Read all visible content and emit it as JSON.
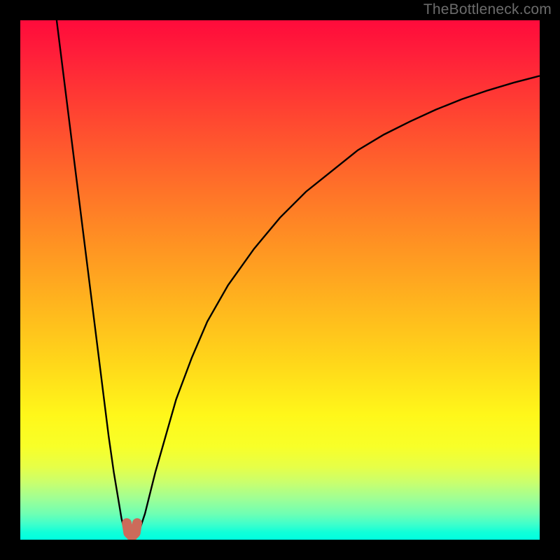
{
  "watermark": "TheBottleneck.com",
  "chart_data": {
    "type": "line",
    "title": "",
    "xlabel": "",
    "ylabel": "",
    "xlim": [
      0,
      100
    ],
    "ylim": [
      0,
      100
    ],
    "grid": false,
    "series": [
      {
        "name": "left-branch",
        "x": [
          7,
          8,
          9,
          10,
          11,
          12,
          13,
          14,
          15,
          16,
          17,
          18,
          19,
          19.5,
          20,
          20.5
        ],
        "values": [
          100,
          92,
          84,
          76,
          68,
          60,
          52,
          44,
          36,
          28,
          20,
          13,
          7,
          4,
          2,
          1
        ]
      },
      {
        "name": "right-branch",
        "x": [
          22.5,
          23,
          24,
          25,
          26,
          28,
          30,
          33,
          36,
          40,
          45,
          50,
          55,
          60,
          65,
          70,
          75,
          80,
          85,
          90,
          95,
          100
        ],
        "values": [
          1,
          2,
          5,
          9,
          13,
          20,
          27,
          35,
          42,
          49,
          56,
          62,
          67,
          71,
          75,
          78,
          80.5,
          82.8,
          84.8,
          86.5,
          88,
          89.3
        ]
      },
      {
        "name": "marker",
        "x": [
          20.5,
          20.8,
          21.5,
          22.2,
          22.5
        ],
        "values": [
          3.2,
          1.3,
          0.6,
          1.3,
          3.2
        ]
      }
    ],
    "marker_color": "#cc6b5a"
  }
}
